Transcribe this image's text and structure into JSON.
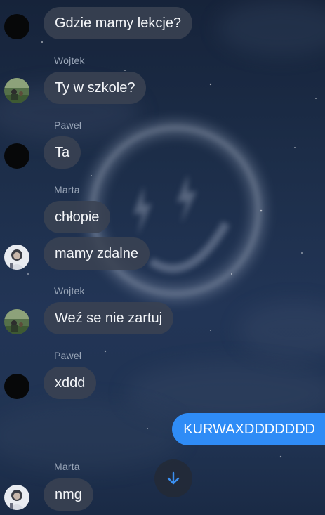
{
  "chat": {
    "messages": [
      {
        "text": "Gdzie mamy lekcje?"
      },
      {
        "sender": "Wojtek",
        "text": "Ty w szkole?"
      },
      {
        "sender": "Paweł",
        "text": "Ta"
      },
      {
        "sender": "Marta",
        "text": "chłopie"
      },
      {
        "text": "mamy zdalne"
      },
      {
        "sender": "Wojtek",
        "text": "Weź se nie zartuj"
      },
      {
        "sender": "Paweł",
        "text": "xddd"
      },
      {
        "text": "KURWAXDDDDDDD"
      },
      {
        "sender": "Marta",
        "text": "nmg"
      }
    ]
  },
  "icons": {
    "scroll_down": "arrow-down-icon"
  },
  "colors": {
    "background": "#1c2d48",
    "incoming_bubble": "#3a4252",
    "outgoing_bubble": "#2f8cf6",
    "sender_name": "#9aa6b8",
    "scroll_arrow": "#3b8ff0"
  }
}
